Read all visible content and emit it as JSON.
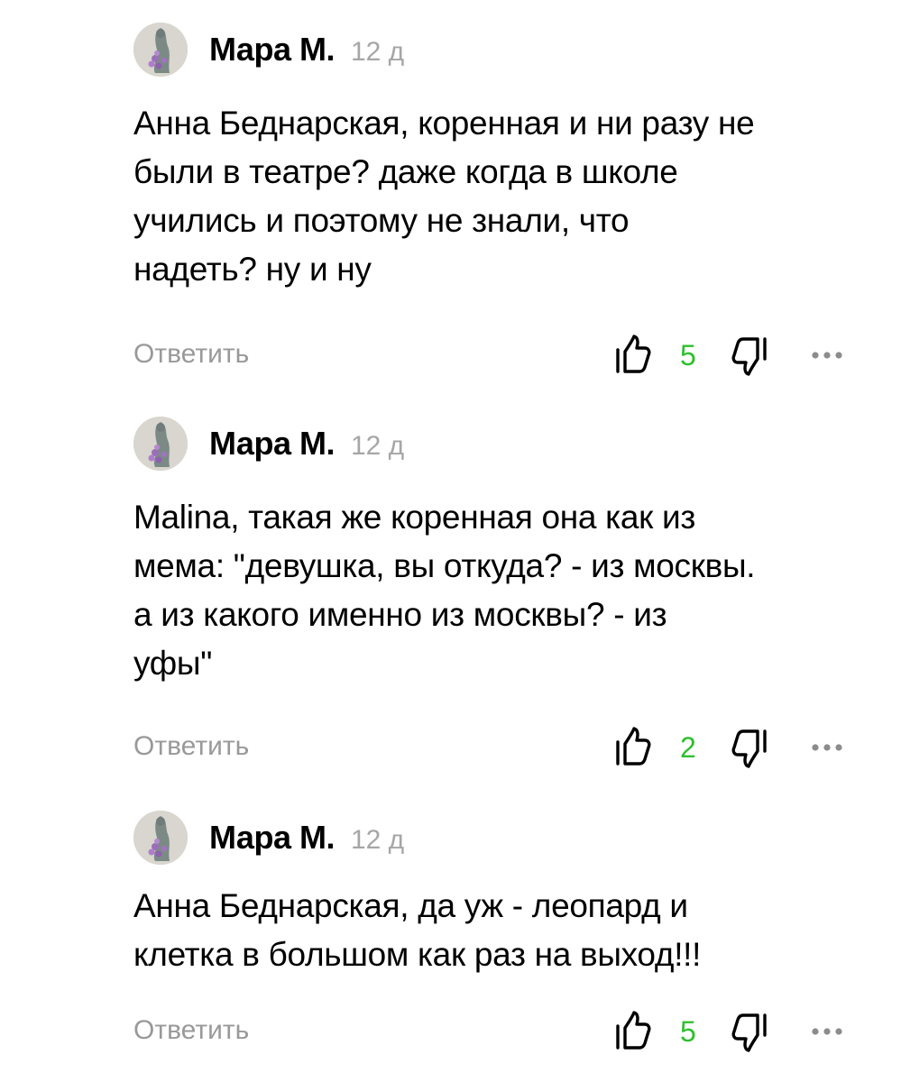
{
  "colors": {
    "like_count": "#2fbf2f",
    "muted_text": "#999999",
    "age_text": "#a6a6a6"
  },
  "icons": {
    "like": "thumbs-up-icon",
    "dislike": "thumbs-down-icon",
    "more": "more-dots-icon"
  },
  "comments": [
    {
      "author": "Мара М.",
      "age": "12 д",
      "text_lines": [
        "Анна Беднарская, коренная и ни разу не",
        "были в театре? даже когда в школе",
        "учились и поэтому не знали, что",
        "надеть? ну и ну"
      ],
      "reply_label": "Ответить",
      "likes": "5"
    },
    {
      "author": "Мара М.",
      "age": "12 д",
      "text_lines": [
        "Malina, такая же коренная она как из",
        "мема: \"девушка, вы откуда? - из москвы.",
        "а из какого именно из москвы? - из",
        "уфы\""
      ],
      "reply_label": "Ответить",
      "likes": "2"
    },
    {
      "author": "Мара М.",
      "age": "12 д",
      "text_lines": [
        "Анна Беднарская, да уж - леопард и",
        "клетка в большом как раз на выход!!!"
      ],
      "reply_label": "Ответить",
      "likes": "5"
    }
  ]
}
